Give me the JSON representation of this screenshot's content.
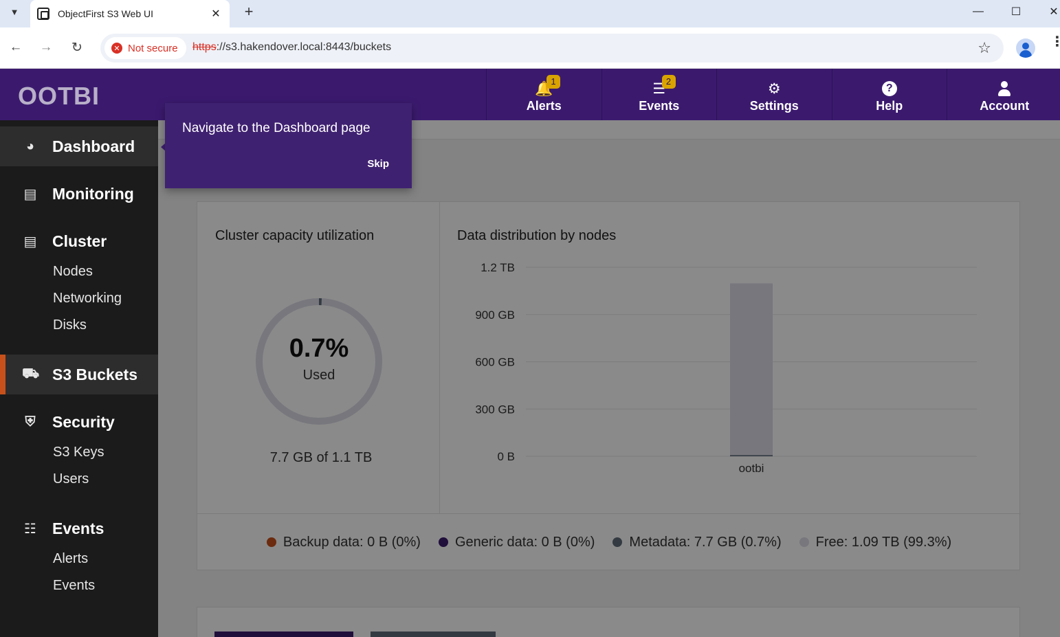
{
  "browser": {
    "tab_title": "ObjectFirst S3 Web UI",
    "new_tab_symbol": "+",
    "security_label": "Not secure",
    "url_scheme": "https",
    "url_rest": "://s3.hakendover.local:8443/buckets"
  },
  "header": {
    "logo": "OOTBI",
    "nav": [
      {
        "label": "Alerts",
        "icon": "bell-icon",
        "badge": "1"
      },
      {
        "label": "Events",
        "icon": "list-icon",
        "badge": "2"
      },
      {
        "label": "Settings",
        "icon": "gear-icon"
      },
      {
        "label": "Help",
        "icon": "help-icon"
      },
      {
        "label": "Account",
        "icon": "user-icon"
      }
    ]
  },
  "sidebar": {
    "dashboard": "Dashboard",
    "monitoring": "Monitoring",
    "cluster": "Cluster",
    "cluster_items": [
      "Nodes",
      "Networking",
      "Disks"
    ],
    "s3_buckets": "S3 Buckets",
    "security": "Security",
    "security_items": [
      "S3 Keys",
      "Users"
    ],
    "events": "Events",
    "events_items": [
      "Alerts",
      "Events"
    ]
  },
  "tour": {
    "text": "Navigate to the Dashboard page",
    "skip": "Skip"
  },
  "capacity": {
    "title": "Cluster capacity utilization",
    "percent": "0.7%",
    "used_label": "Used",
    "summary": "7.7 GB of 1.1 TB",
    "used_fraction": 0.007
  },
  "distribution": {
    "title": "Data distribution by nodes"
  },
  "chart_data": {
    "type": "bar",
    "title": "Data distribution by nodes",
    "categories": [
      "ootbi"
    ],
    "y_tick_labels": [
      "0 B",
      "300 GB",
      "600 GB",
      "900 GB",
      "1.2 TB"
    ],
    "y_tick_values_gb": [
      0,
      300,
      600,
      900,
      1200
    ],
    "ylim_gb": [
      0,
      1200
    ],
    "series": [
      {
        "name": "Metadata",
        "values_gb": [
          7.7
        ],
        "color": "#5f6b7a"
      },
      {
        "name": "Free",
        "values_gb": [
          1090
        ],
        "color": "#dcdde8"
      }
    ]
  },
  "legend": [
    {
      "label": "Backup data: 0 B (0%)",
      "color": "#c8511b"
    },
    {
      "label": "Generic data: 0 B (0%)",
      "color": "#3b1a6e"
    },
    {
      "label": "Metadata: 7.7 GB (0.7%)",
      "color": "#5f6b7a"
    },
    {
      "label": "Free: 1.09 TB (99.3%)",
      "color": "#dcdde8"
    }
  ],
  "colors": {
    "brand": "#3b1a6e",
    "accent": "#c8511b",
    "sidebar": "#1b1b1b"
  }
}
